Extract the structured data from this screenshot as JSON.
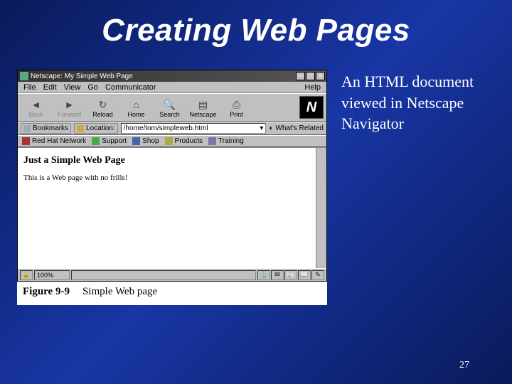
{
  "slide": {
    "title": "Creating Web Pages",
    "side_caption": "An HTML document viewed in Netscape Navigator",
    "page_number": "27"
  },
  "figure": {
    "label": "Figure 9-9",
    "caption": "Simple Web page"
  },
  "window": {
    "title": "Netscape: My Simple Web Page"
  },
  "menubar": {
    "file": "File",
    "edit": "Edit",
    "view": "View",
    "go": "Go",
    "communicator": "Communicator",
    "help": "Help"
  },
  "toolbar": {
    "back": "Back",
    "forward": "Forward",
    "reload": "Reload",
    "home": "Home",
    "search": "Search",
    "netscape": "Netscape",
    "print": "Print",
    "logo": "N"
  },
  "location": {
    "bookmarks": "Bookmarks",
    "label": "Location:",
    "value": "/home/tom/simpleweb.html",
    "related": "What's Related"
  },
  "personal_toolbar": {
    "items": [
      "Red Hat Network",
      "Support",
      "Shop",
      "Products",
      "Training"
    ]
  },
  "page": {
    "heading": "Just a Simple Web Page",
    "body": "This is a Web page with no frills!"
  },
  "statusbar": {
    "zoom": "100%"
  }
}
